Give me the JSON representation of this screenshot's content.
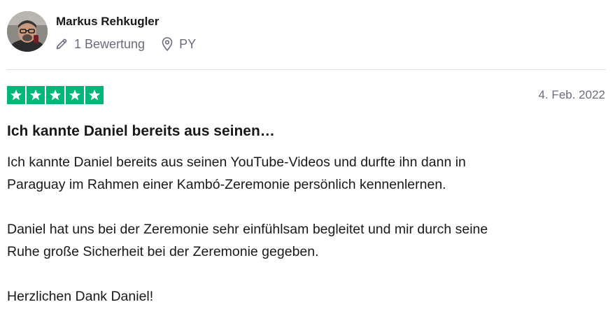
{
  "reviewer": {
    "name": "Markus Rehkugler",
    "review_count": "1 Bewertung",
    "country": "PY",
    "avatar_icon": "user-photo",
    "review_count_icon": "pencil-icon",
    "country_icon": "location-pin-icon"
  },
  "review": {
    "rating": 5,
    "rating_max": 5,
    "star_color": "#00b67a",
    "date": "4. Feb. 2022",
    "title": "Ich kannte Daniel bereits aus seinen…",
    "paragraphs": [
      "Ich kannte Daniel bereits aus seinen YouTube-Videos und durfte ihn dann in\nParaguay im Rahmen einer Kambó-Zeremonie persönlich kennenlernen.",
      "Daniel hat uns bei der Zeremonie sehr einfühlsam begleitet und mir durch seine\nRuhe große Sicherheit bei der Zeremonie gegeben.",
      "Herzlichen Dank Daniel!"
    ]
  },
  "colors": {
    "text": "#191919",
    "muted": "#6b6b80",
    "divider": "#e2e2e6"
  }
}
